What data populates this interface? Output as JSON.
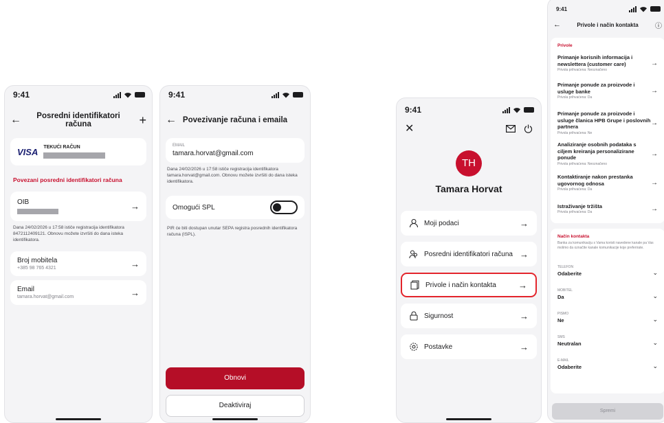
{
  "status_time": "9:41",
  "screen1": {
    "title": "Posredni identifikatori računa",
    "card_brand": "VISA",
    "card_label": "TEKUĆI RAČUN",
    "section_title": "Povezani posredni identifikatori računa",
    "oib_label": "OIB",
    "oib_note": "Dana 24/02/2026 u 17:58 ističe registracija identifikatora 8472112409121. Obnovu možete izvršiti do dana isteka identifikatora.",
    "mobile_label": "Broj mobitela",
    "mobile_value": "+385 98 765 4321",
    "email_label": "Email",
    "email_value": "tamara.horvat@gmail.com"
  },
  "screen2": {
    "title": "Povezivanje računa i emaila",
    "field_label": "EMAIL",
    "field_value": "tamara.horvat@gmail.com",
    "note": "Dana 24/02/2026 u 17:58 ističe registracija identifikatora tamara.horvat@gmail.com. Obnovu možete izvršiti do dana isteka identifikatora.",
    "toggle_label": "Omogući SPL",
    "toggle_note": "PIR će biti dostupan unutar SEPA registra posrednih identifikatora računa (ISPL).",
    "primary_button": "Obnovi",
    "secondary_button": "Deaktiviraj"
  },
  "screen3": {
    "initials": "TH",
    "name": "Tamara Horvat",
    "menu": [
      {
        "label": "Moji podaci",
        "icon": "user-icon"
      },
      {
        "label": "Posredni identifikatori računa",
        "icon": "users-icon"
      },
      {
        "label": "Privole i način kontakta",
        "icon": "document-icon"
      },
      {
        "label": "Sigurnost",
        "icon": "lock-icon"
      },
      {
        "label": "Postavke",
        "icon": "gear-icon"
      }
    ]
  },
  "screen4": {
    "title": "Privole i način kontakta",
    "privole_title": "Privole",
    "privole": [
      {
        "title": "Primanje korisnih informacija i newslettera (customer care)",
        "status": "Privola prihvaćena: Neoznačeno"
      },
      {
        "title": "Primanje ponude za proizvode i usluge banke",
        "status": "Privola prihvaćena: Da"
      },
      {
        "title": "Primanje ponude za proizvode i usluge članica HPB Grupe i poslovnih partnera",
        "status": "Privola prihvaćena: Ne"
      },
      {
        "title": "Analiziranje osobnih podataka s ciljem kreiranja personalizirane ponude",
        "status": "Privola prihvaćena: Neoznačeno"
      },
      {
        "title": "Kontaktiranje nakon prestanka ugovornog odnosa",
        "status": "Privola prihvaćena: Da"
      },
      {
        "title": "Istraživanje tržišta",
        "status": "Privola prihvaćena: Da"
      }
    ],
    "contact_title": "Način kontakta",
    "contact_note": "Banka za komunikaciju s Vama koristi navedene kanale pa Vas molimo da označite kanale komunikacije koje preferirate.",
    "fields": [
      {
        "key": "TELEFON",
        "value": "Odaberite"
      },
      {
        "key": "MOBITEL",
        "value": "Da"
      },
      {
        "key": "PISMO",
        "value": "Ne"
      },
      {
        "key": "SMS",
        "value": "Neutralan"
      },
      {
        "key": "E-MAIL",
        "value": "Odaberite"
      }
    ],
    "save_button": "Spremi"
  },
  "colors": {
    "accent": "#c8102e",
    "button": "#b50e27",
    "highlight": "#e3242b",
    "background": "#f4f4f6"
  }
}
